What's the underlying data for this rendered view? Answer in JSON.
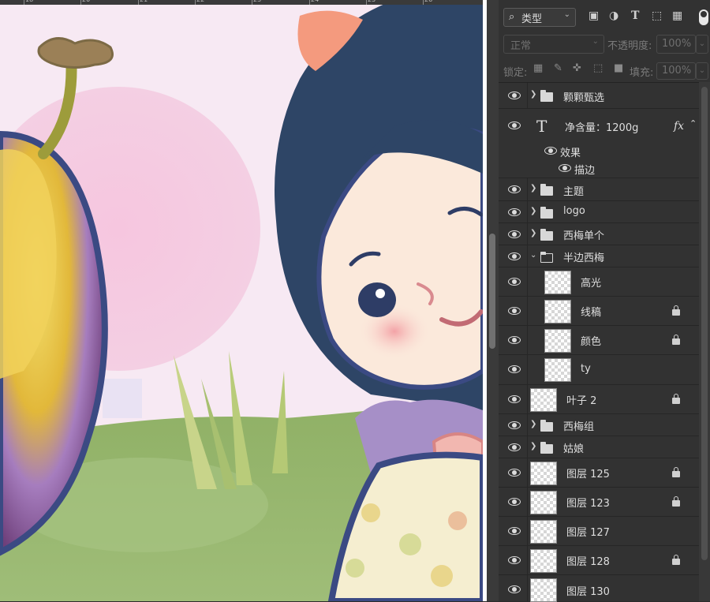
{
  "ruler": {
    "numbers": [
      "18",
      "20",
      "21",
      "22",
      "23",
      "24",
      "25",
      "26"
    ]
  },
  "toolbar": {
    "filter_label": "类型",
    "blend_mode": "正常",
    "opacity_label": "不透明度:",
    "opacity_value": "100%",
    "lock_label": "锁定:",
    "fill_label": "填充:",
    "fill_value": "100%",
    "filter_icons": [
      "image-filter-icon",
      "adjustment-filter-icon",
      "type-filter-icon",
      "shape-filter-icon",
      "smart-object-filter-icon"
    ],
    "lock_icons": [
      "lock-transparent-icon",
      "lock-paint-icon",
      "lock-position-icon",
      "lock-artboard-icon",
      "lock-all-icon"
    ]
  },
  "layers": [
    {
      "name": "颗颗甄选",
      "kind": "group",
      "expanded": false
    },
    {
      "name": "净含量：1200g",
      "kind": "text",
      "fx": "fx"
    },
    {
      "name": "效果",
      "kind": "effects"
    },
    {
      "name": "描边",
      "kind": "effect"
    },
    {
      "name": "主题",
      "kind": "group",
      "expanded": false
    },
    {
      "name": "logo",
      "kind": "group",
      "expanded": false
    },
    {
      "name": "西梅单个",
      "kind": "group",
      "expanded": false
    },
    {
      "name": "半边西梅",
      "kind": "group",
      "expanded": true
    },
    {
      "name": "高光",
      "kind": "pixel",
      "locked": false
    },
    {
      "name": "线稿",
      "kind": "pixel",
      "locked": true
    },
    {
      "name": "颜色",
      "kind": "pixel",
      "locked": true
    },
    {
      "name": "ty",
      "kind": "pixel",
      "locked": false
    },
    {
      "name": "叶子 2",
      "kind": "pixel",
      "locked": true
    },
    {
      "name": "西梅组",
      "kind": "group",
      "expanded": false
    },
    {
      "name": "姑娘",
      "kind": "group",
      "expanded": false
    },
    {
      "name": "图层 125",
      "kind": "pixel",
      "locked": true
    },
    {
      "name": "图层 123",
      "kind": "pixel",
      "locked": true
    },
    {
      "name": "图层 127",
      "kind": "pixel",
      "locked": false
    },
    {
      "name": "图层 128",
      "kind": "pixel",
      "locked": true
    },
    {
      "name": "图层 130",
      "kind": "pixel",
      "locked": false
    }
  ]
}
